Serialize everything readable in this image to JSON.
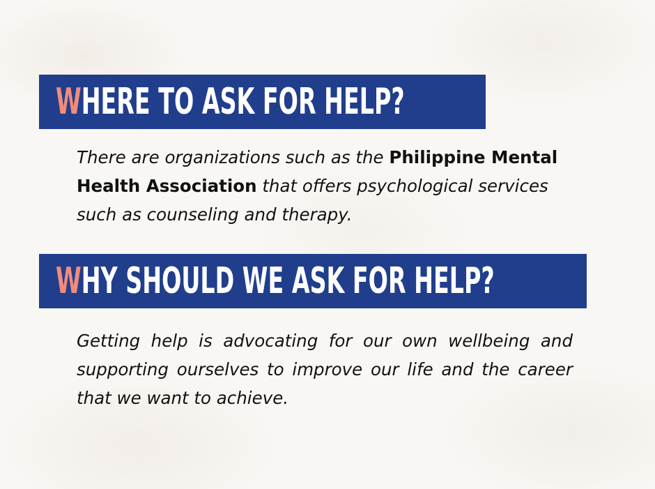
{
  "section_where": {
    "heading_initial": "W",
    "heading_rest": "HERE TO ASK FOR HELP?",
    "body": {
      "intro": "There are organizations such as the ",
      "organization": "Philippine Mental Health Association",
      "rest": " that offers psychological services such as counseling and therapy."
    }
  },
  "section_why": {
    "heading_initial": "W",
    "heading_rest": "HY SHOULD WE ASK FOR HELP?",
    "body": "Getting help is advocating for our own wellbeing and supporting ourselves to improve our life and the career that we want to achieve."
  },
  "colors": {
    "banner": "#213e8c",
    "accent_initial": "#f28b7a",
    "heading_text": "#ffffff",
    "body_text": "#111111",
    "background": "#f9f7f4"
  }
}
